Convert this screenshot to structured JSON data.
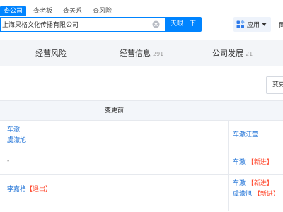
{
  "search": {
    "tabs": [
      "查公司",
      "查老板",
      "查关系",
      "查风险"
    ],
    "value": "上海果格文化传播有限公司",
    "button_label": "天眼一下"
  },
  "header": {
    "apps_label": "应用",
    "edge_text": "商"
  },
  "sections": [
    {
      "label": "经营风险",
      "count": ""
    },
    {
      "label": "经营信息",
      "count": "291"
    },
    {
      "label": "公司发展",
      "count": "21"
    }
  ],
  "change_button_label": "变更",
  "table": {
    "header_before": "变更前",
    "rows": [
      {
        "before": [
          "车澈",
          "虞濛旭"
        ],
        "after": [
          {
            "name": "车澈汪莹",
            "tag": ""
          }
        ]
      },
      {
        "before_text": "-",
        "after": [
          {
            "name": "车澈",
            "tag": "【新进】"
          }
        ]
      },
      {
        "before_tagged": {
          "name": "李嘉格",
          "tag": "【退出】"
        },
        "after": [
          {
            "name": "车澈",
            "tag": "【新进】"
          },
          {
            "name": "虞濛旭",
            "tag": "【新进】"
          }
        ]
      }
    ]
  },
  "colors": {
    "primary": "#0084ff",
    "link": "#1a6fd6",
    "tag": "#ff4a2f"
  },
  "icons": [
    "clear-icon",
    "apps-icon",
    "chevron-down-icon"
  ]
}
